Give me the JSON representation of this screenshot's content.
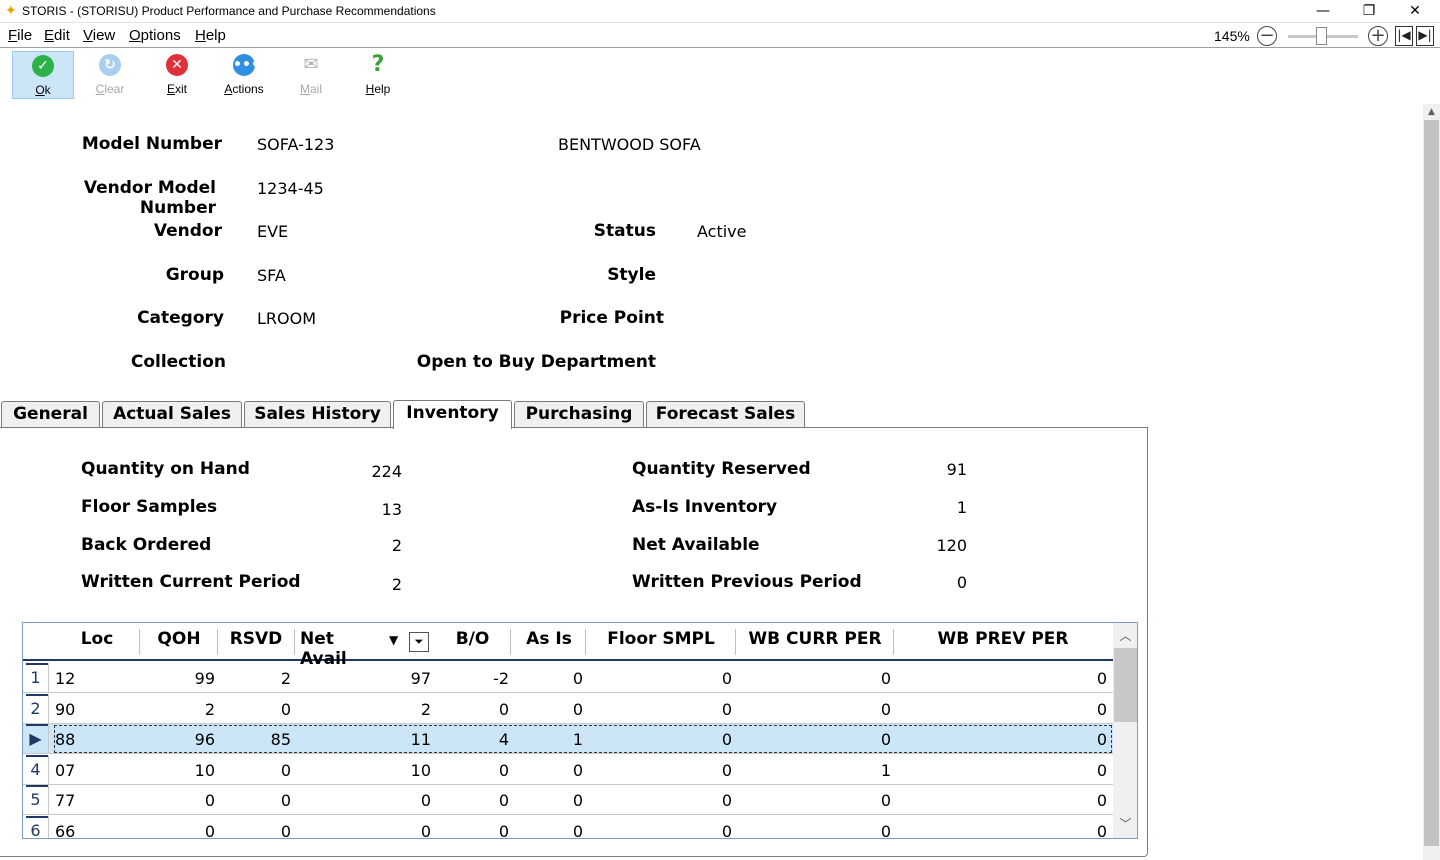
{
  "window": {
    "title": "STORIS - (STORISU) Product Performance and Purchase Recommendations",
    "minimize": "—",
    "restore": "❐",
    "close": "✕"
  },
  "menu": {
    "items": [
      {
        "u": "F",
        "rest": "ile"
      },
      {
        "u": "E",
        "rest": "dit"
      },
      {
        "u": "V",
        "rest": "iew"
      },
      {
        "u": "O",
        "rest": "ptions"
      },
      {
        "u": "H",
        "rest": "elp"
      }
    ],
    "zoom": "145%"
  },
  "toolbar": {
    "ok": {
      "u": "O",
      "rest": "k"
    },
    "clear": {
      "u": "C",
      "rest": "lear"
    },
    "exit": {
      "u": "E",
      "rest": "xit"
    },
    "actions": {
      "u": "A",
      "rest": "ctions"
    },
    "mail": {
      "u": "M",
      "rest": "ail"
    },
    "help": {
      "u": "H",
      "rest": "elp"
    }
  },
  "header": {
    "model_number_label": "Model Number",
    "model_number": "SOFA-123",
    "description": "BENTWOOD SOFA",
    "vendor_model_label": "Vendor Model Number",
    "vendor_model": "1234-45",
    "vendor_label": "Vendor",
    "vendor": "EVE",
    "status_label": "Status",
    "status": "Active",
    "group_label": "Group",
    "group": "SFA",
    "style_label": "Style",
    "category_label": "Category",
    "category": "LROOM",
    "price_point_label": "Price Point",
    "collection_label": "Collection",
    "otb_label": "Open to Buy Department"
  },
  "tabs": [
    "General",
    "Actual Sales",
    "Sales History",
    "Inventory",
    "Purchasing",
    "Forecast Sales"
  ],
  "active_tab": "Inventory",
  "inventory": {
    "qoh_label": "Quantity on Hand",
    "qoh": "224",
    "reserved_label": "Quantity Reserved",
    "reserved": "91",
    "floor_label": "Floor Samples",
    "floor": "13",
    "asis_label": "As-Is Inventory",
    "asis": "1",
    "backordered_label": "Back Ordered",
    "backordered": "2",
    "net_label": "Net Available",
    "net": "120",
    "wcur_label": "Written Current Period",
    "wcur": "2",
    "wprev_label": "Written Previous Period",
    "wprev": "0"
  },
  "grid": {
    "columns": [
      "Loc",
      "QOH",
      "RSVD",
      "Net Avail",
      "B/O",
      "As Is",
      "Floor SMPL",
      "WB CURR PER",
      "WB PREV PER"
    ],
    "rows": [
      {
        "num": "1",
        "cells": [
          "12",
          "99",
          "2",
          "97",
          "-2",
          "0",
          "0",
          "0",
          "0"
        ]
      },
      {
        "num": "2",
        "cells": [
          "90",
          "2",
          "0",
          "2",
          "0",
          "0",
          "0",
          "0",
          "0"
        ]
      },
      {
        "num": "▶",
        "cells": [
          "88",
          "96",
          "85",
          "11",
          "4",
          "1",
          "0",
          "0",
          "0"
        ]
      },
      {
        "num": "4",
        "cells": [
          "07",
          "10",
          "0",
          "10",
          "0",
          "0",
          "0",
          "1",
          "0"
        ]
      },
      {
        "num": "5",
        "cells": [
          "77",
          "0",
          "0",
          "0",
          "0",
          "0",
          "0",
          "0",
          "0"
        ]
      },
      {
        "num": "6",
        "cells": [
          "66",
          "0",
          "0",
          "0",
          "0",
          "0",
          "0",
          "0",
          "0"
        ]
      }
    ],
    "selected_row": 2
  },
  "colors": {
    "accent": "#cde6f7",
    "ok": "#2db24a",
    "exit": "#e0303a",
    "actions": "#2f8fe0",
    "help": "#3aa33a"
  }
}
